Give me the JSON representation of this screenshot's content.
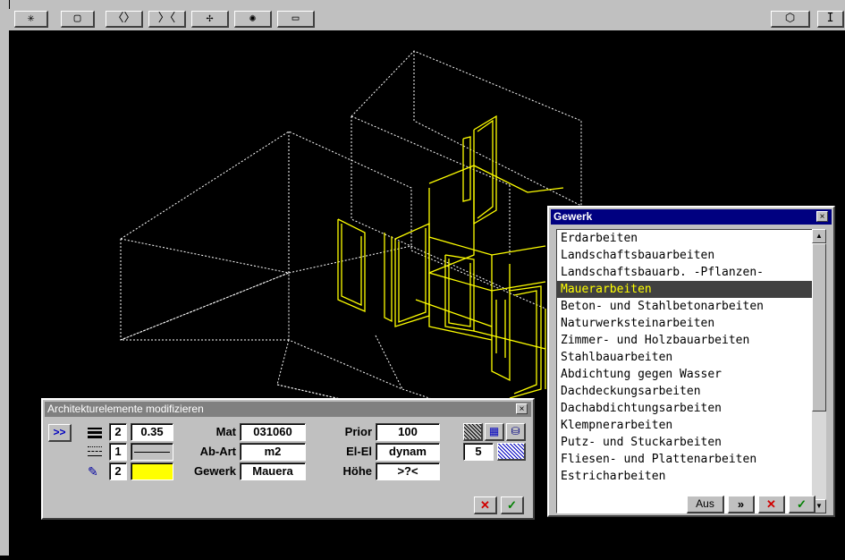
{
  "toolbar": {
    "buttons": [
      "✳",
      "▢",
      "〈〉",
      "〉〈",
      "✢",
      "✺",
      "▭"
    ],
    "right_buttons": [
      "⬡",
      "I"
    ]
  },
  "arch_dialog": {
    "title": "Architekturelemente modifizieren",
    "close": "×",
    "expand": ">>",
    "line_width_num": "2",
    "line_width_val": "0.35",
    "line_type_num": "1",
    "pen_num": "2",
    "pen_color": "#ffff00",
    "mat_label": "Mat",
    "mat_value": "031060",
    "abart_label": "Ab-Art",
    "abart_value": "m2",
    "gewerk_label": "Gewerk",
    "gewerk_value": "Mauera",
    "prior_label": "Prior",
    "prior_value": "100",
    "elel_label": "El-El",
    "elel_value": "dynam",
    "hoehe_label": "Höhe",
    "hoehe_value": ">?<",
    "hatch_num": "5",
    "cancel": "✕",
    "ok": "✓"
  },
  "gewerk_dialog": {
    "title": "Gewerk",
    "close": "×",
    "items": [
      "Erdarbeiten",
      "Landschaftsbauarbeiten",
      "Landschaftsbauarb. -Pflanzen-",
      "Mauerarbeiten",
      "Beton- und Stahlbetonarbeiten",
      "Naturwerksteinarbeiten",
      "Zimmer- und Holzbauarbeiten",
      "Stahlbauarbeiten",
      "Abdichtung gegen Wasser",
      "Dachdeckungsarbeiten",
      "Dachabdichtungsarbeiten",
      "Klempnerarbeiten",
      "Putz- und Stuckarbeiten",
      "Fliesen- und Plattenarbeiten",
      "Estricharbeiten"
    ],
    "selected_index": 3,
    "aus_label": "Aus",
    "next_label": "»",
    "cancel": "✕",
    "ok": "✓"
  },
  "colors": {
    "title_active": "#000080",
    "title_inactive": "#808080",
    "wire_white": "#ffffff",
    "wire_yellow": "#ffff00",
    "cancel_red": "#d00000",
    "ok_green": "#008000"
  }
}
